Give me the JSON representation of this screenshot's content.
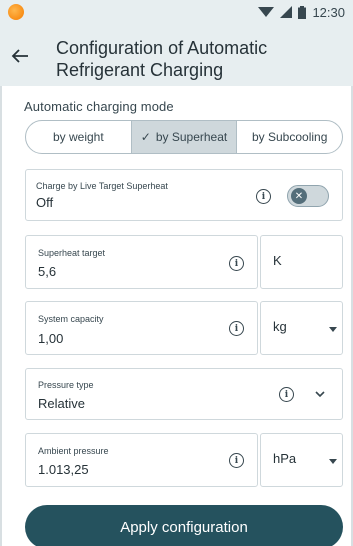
{
  "status_bar": {
    "time": "12:30"
  },
  "header": {
    "title": "Configuration of Automatic Refrigerant Charging"
  },
  "charging_mode": {
    "label": "Automatic charging mode",
    "options": [
      "by weight",
      "by Superheat",
      "by Subcooling"
    ],
    "selected": "by Superheat"
  },
  "live_target": {
    "label": "Charge by Live Target Superheat",
    "value": "Off"
  },
  "superheat_target": {
    "label": "Superheat target",
    "value": "5,6",
    "unit": "K"
  },
  "system_capacity": {
    "label": "System capacity",
    "value": "1,00",
    "unit": "kg"
  },
  "pressure_type": {
    "label": "Pressure type",
    "value": "Relative"
  },
  "ambient_pressure": {
    "label": "Ambient pressure",
    "value": "1.013,25",
    "unit": "hPa"
  },
  "apply_label": "Apply configuration",
  "colors": {
    "header_bg": "#e7eef0",
    "primary": "#25525e",
    "segment_active": "#cfd8dc"
  },
  "icons": {
    "app": "app-logo-icon",
    "wifi": "wifi-icon",
    "signal": "signal-icon",
    "battery": "battery-icon",
    "back": "back-arrow-icon",
    "info": "info-icon",
    "check": "check-icon",
    "dropdown": "dropdown-caret-icon",
    "chevron": "chevron-down-icon"
  }
}
